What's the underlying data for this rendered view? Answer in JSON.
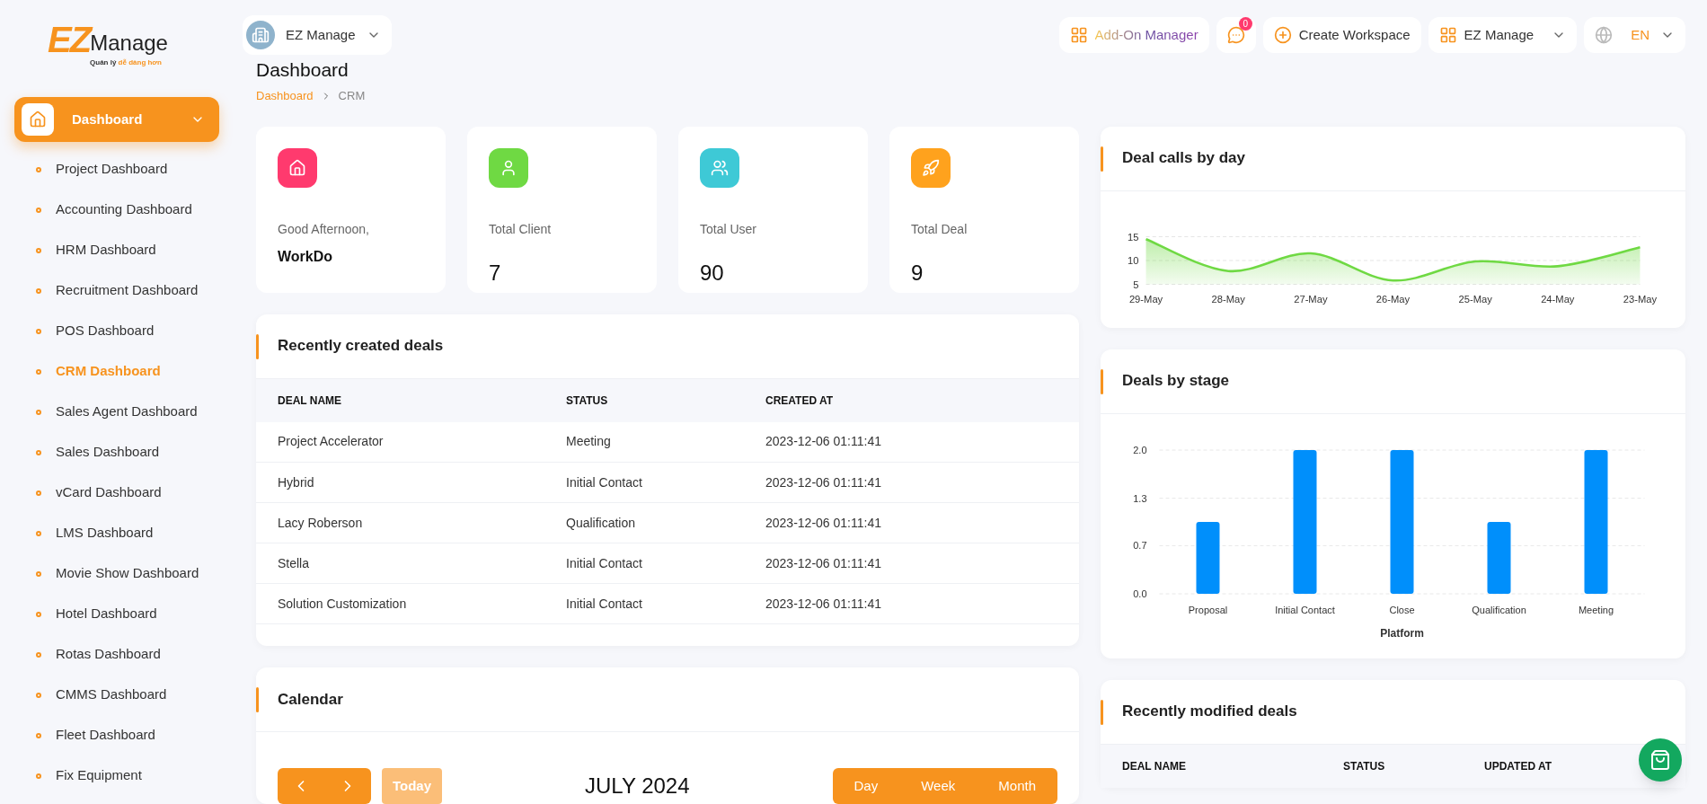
{
  "logo": {
    "brand_prefix": "EZ",
    "brand_name": "Manage",
    "tagline_plain": "Quản lý ",
    "tagline_accent": "dễ dàng hơn"
  },
  "sidebar": {
    "section": {
      "label": "Dashboard",
      "expanded": true
    },
    "items": [
      {
        "label": "Project Dashboard",
        "selected": false
      },
      {
        "label": "Accounting Dashboard",
        "selected": false
      },
      {
        "label": "HRM Dashboard",
        "selected": false
      },
      {
        "label": "Recruitment Dashboard",
        "selected": false
      },
      {
        "label": "POS Dashboard",
        "selected": false
      },
      {
        "label": "CRM Dashboard",
        "selected": true
      },
      {
        "label": "Sales Agent Dashboard",
        "selected": false
      },
      {
        "label": "Sales Dashboard",
        "selected": false
      },
      {
        "label": "vCard Dashboard",
        "selected": false
      },
      {
        "label": "LMS Dashboard",
        "selected": false
      },
      {
        "label": "Movie Show Dashboard",
        "selected": false
      },
      {
        "label": "Hotel Dashboard",
        "selected": false
      },
      {
        "label": "Rotas Dashboard",
        "selected": false
      },
      {
        "label": "CMMS Dashboard",
        "selected": false
      },
      {
        "label": "Fleet Dashboard",
        "selected": false
      },
      {
        "label": "Fix Equipment",
        "selected": false
      }
    ]
  },
  "workspace_switcher": {
    "label": "EZ Manage"
  },
  "topbar": {
    "addon_manager": "Add-On Manager",
    "messages_badge": "0",
    "create_workspace": "Create Workspace",
    "workspace_menu": "EZ Manage",
    "language": "EN"
  },
  "page": {
    "title": "Dashboard",
    "breadcrumb": [
      "Dashboard",
      "CRM"
    ]
  },
  "stats": [
    {
      "kind": "greeting",
      "color": "#ff3a6e",
      "label": "Good Afternoon,",
      "value": "WorkDo"
    },
    {
      "kind": "count",
      "color": "#6fd943",
      "label": "Total Client",
      "value": "7"
    },
    {
      "kind": "count",
      "color": "#3ec9d6",
      "label": "Total User",
      "value": "90"
    },
    {
      "kind": "count",
      "color": "#ffa21d",
      "label": "Total Deal",
      "value": "9"
    }
  ],
  "recent_deals": {
    "title": "Recently created deals",
    "columns": [
      "DEAL NAME",
      "STATUS",
      "CREATED AT"
    ],
    "rows": [
      [
        "Project Accelerator",
        "Meeting",
        "2023-12-06 01:11:41"
      ],
      [
        "Hybrid",
        "Initial Contact",
        "2023-12-06 01:11:41"
      ],
      [
        "Lacy Roberson",
        "Qualification",
        "2023-12-06 01:11:41"
      ],
      [
        "Stella",
        "Initial Contact",
        "2023-12-06 01:11:41"
      ],
      [
        "Solution Customization",
        "Initial Contact",
        "2023-12-06 01:11:41"
      ]
    ]
  },
  "calendar": {
    "title": "Calendar",
    "today": "Today",
    "month_title": "JULY 2024",
    "views": [
      "Day",
      "Week",
      "Month"
    ]
  },
  "deal_calls": {
    "title": "Deal calls by day",
    "chart_data": {
      "type": "area",
      "categories": [
        "29-May",
        "28-May",
        "27-May",
        "26-May",
        "25-May",
        "24-May",
        "23-May"
      ],
      "series": [
        {
          "color": "#6fd943",
          "values": [
            14.5,
            7.8,
            11.5,
            5.8,
            9.8,
            8.8,
            12.8
          ]
        }
      ],
      "yticks": [
        5,
        10,
        15
      ],
      "ylim": [
        5,
        15
      ]
    }
  },
  "deals_by_stage": {
    "title": "Deals by stage",
    "chart_data": {
      "type": "bar",
      "xlabel": "Platform",
      "categories": [
        "Proposal",
        "Initial Contact",
        "Close",
        "Qualification",
        "Meeting"
      ],
      "series": [
        {
          "color": "#008ffb",
          "values": [
            1,
            2,
            2,
            1,
            2
          ]
        }
      ],
      "ylim": [
        0,
        2
      ],
      "yticks": [
        {
          "value": 0,
          "label": "0.0"
        },
        {
          "value": 0.67,
          "label": "0.7"
        },
        {
          "value": 1.33,
          "label": "1.3"
        },
        {
          "value": 2,
          "label": "2.0"
        }
      ]
    }
  },
  "recent_modified": {
    "title": "Recently modified deals",
    "columns": [
      "DEAL NAME",
      "STATUS",
      "UPDATED AT"
    ]
  }
}
